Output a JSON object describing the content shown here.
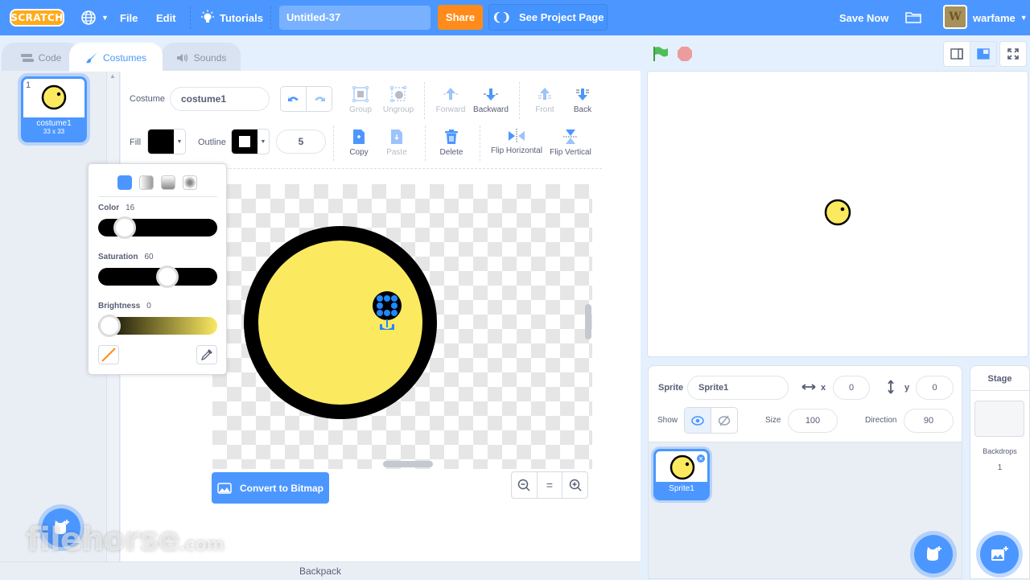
{
  "menubar": {
    "logo": "SCRATCH",
    "file": "File",
    "edit": "Edit",
    "tutorials": "Tutorials",
    "project_title": "Untitled-37",
    "share": "Share",
    "see_project_page": "See Project Page",
    "save_now": "Save Now",
    "username": "warfame",
    "avatar_letter": "W",
    "accent": "#4c97ff",
    "share_color": "#ff8c1a"
  },
  "tabs": [
    {
      "label": "Code",
      "icon": "code-blocks-icon"
    },
    {
      "label": "Costumes",
      "icon": "paintbrush-icon",
      "active": true
    },
    {
      "label": "Sounds",
      "icon": "speaker-icon"
    }
  ],
  "costume_list": [
    {
      "index": "1",
      "name": "costume1",
      "size": "33 x 33",
      "selected": true
    }
  ],
  "editor": {
    "costume_label": "Costume",
    "costume_name": "costume1",
    "fill_label": "Fill",
    "outline_label": "Outline",
    "outline_width": "5",
    "tools": {
      "group": "Group",
      "ungroup": "Ungroup",
      "forward": "Forward",
      "backward": "Backward",
      "front": "Front",
      "back": "Back",
      "copy": "Copy",
      "paste": "Paste",
      "delete": "Delete",
      "flip_horizontal": "Flip Horizontal",
      "flip_vertical": "Flip Vertical"
    },
    "convert_button": "Convert to Bitmap",
    "zoom_reset": "="
  },
  "color_picker": {
    "color_label": "Color",
    "color_value": "16",
    "saturation_label": "Saturation",
    "saturation_value": "60",
    "brightness_label": "Brightness",
    "brightness_value": "0",
    "color_fraction": 0.16,
    "saturation_fraction": 0.6,
    "brightness_fraction": 0.0
  },
  "stage_controls": {
    "green_flag": "green-flag-icon",
    "stop": "stop-icon"
  },
  "sprite_info": {
    "sprite_label": "Sprite",
    "sprite_name": "Sprite1",
    "x_label": "x",
    "x_value": "0",
    "y_label": "y",
    "y_value": "0",
    "show_label": "Show",
    "size_label": "Size",
    "size_value": "100",
    "direction_label": "Direction",
    "direction_value": "90"
  },
  "sprites": [
    {
      "name": "Sprite1",
      "selected": true
    }
  ],
  "stage_pane": {
    "title": "Stage",
    "backdrops_label": "Backdrops",
    "backdrops_count": "1"
  },
  "backpack": "Backpack",
  "watermark": {
    "main": "filehorse",
    "suffix": ".com"
  }
}
